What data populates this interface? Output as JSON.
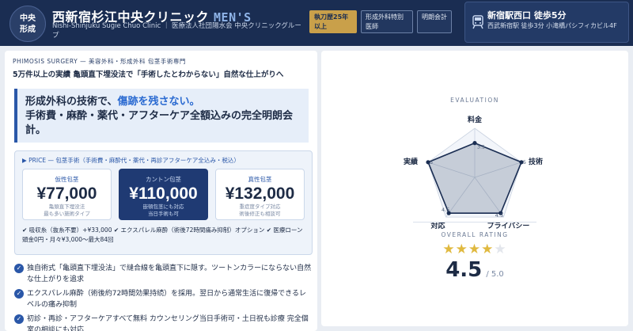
{
  "header": {
    "logo_badge": "中央\n形成",
    "clinic_name": "西新宿杉江中央クリニック",
    "clinic_mens": "MEN'S",
    "clinic_sub": "Nishi-Shinjuku Sugie Chuo Clinic ｜ 医療法人社団陽水会 中央クリニックグループ",
    "tags": [
      "執刀歴25年以上",
      "形成外科特別医師",
      "明朗会計"
    ],
    "station_title": "新宿駅西口 徒歩5分",
    "station_detail": "西武新宿駅 徒歩3分 小滝橋パシフィカビル4F",
    "accent_color": "#c9a04a",
    "bg_color": "#1a2d52"
  },
  "left": {
    "eyebrow": "PHIMOSIS SURGERY — 美容外科・形成外科 包茎手術専門",
    "lead": "5万件以上の実績 亀頭直下埋没法で「手術したとわからない」自然な仕上がりへ",
    "hero_line1_prefix": "形成外科の技術で、",
    "hero_line1_accent": "傷跡を残さない。",
    "hero_line2": "手術費・麻酔・薬代・アフターケア全額込みの完全明朗会計。",
    "price_head": "▶ PRICE — 包茎手術（手術費・麻酔代・薬代・再診アフターケア全込み・税込）",
    "prices": [
      {
        "name": "仮性包茎",
        "price": "¥77,000",
        "note1": "亀頭直下埋没法",
        "note2": "最も多い施術タイプ"
      },
      {
        "name": "カントン包茎",
        "price": "¥110,000",
        "note1": "嵌頓包茎にも対応",
        "note2": "当日手術も可"
      },
      {
        "name": "真性包茎",
        "price": "¥132,000",
        "note1": "重症度タイプ対応",
        "note2": "術後修正も相談可"
      }
    ],
    "extras": "✔ 吸収糸（抜糸不要）+¥33,000 ✔ エクスパレル麻酔（術後72時間痛み抑制）オプション ✔ 医療ローン 頭金0円・月々¥3,000〜最大84回",
    "features": [
      "独自術式「亀頭直下埋没法」で縫合線を亀頭直下に隠す。ツートンカラーにならない自然な仕上がりを追求",
      "エクスパレル麻酔（術後約72時間効果持続）を採用。翌日から通常生活に復帰できるレベルの痛み抑制",
      "初診・再診・アフターケアすべて無料 カウンセリング当日手術可・土日祝も診療 完全個室の相談にも対応"
    ]
  },
  "right": {
    "eval_label": "EVALUATION",
    "axes": [
      {
        "label": "料金",
        "value": 3.5
      },
      {
        "label": "技術",
        "value": 5
      },
      {
        "label": "プライバシー",
        "value": 4.5
      },
      {
        "label": "対応",
        "value": 4.5
      },
      {
        "label": "実績",
        "value": 5
      }
    ],
    "axis_values_text": [
      "3.5",
      "5",
      "4.5",
      "4.5",
      "5"
    ],
    "overall_label": "OVERALL RATING",
    "rating": "4.5",
    "rating_out": "/ 5.0",
    "stars": "★★★★",
    "star_half": "★",
    "star_color": "#e0b93f"
  }
}
